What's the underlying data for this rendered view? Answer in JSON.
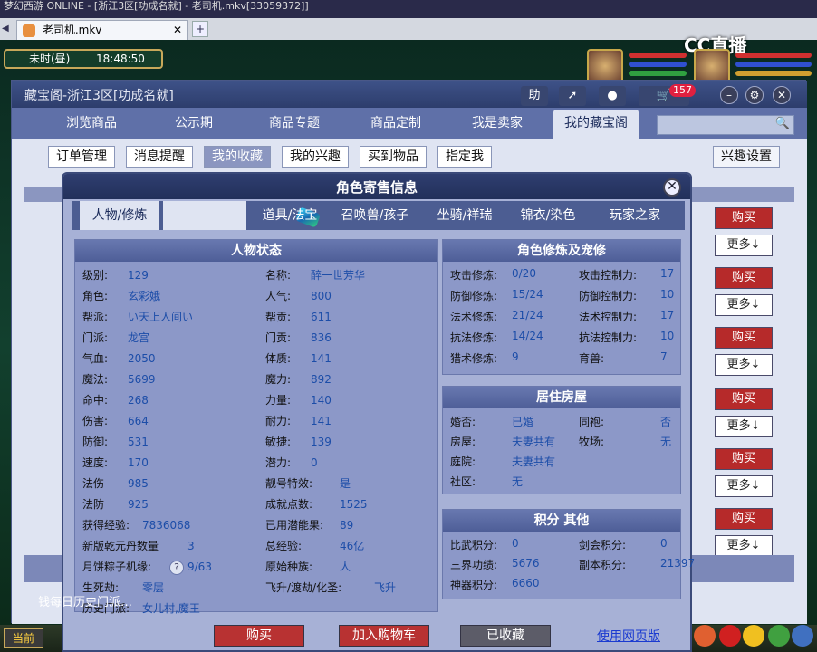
{
  "window": {
    "title": "梦幻西游 ONLINE - [浙江3区[功成名就] - 老司机.mkv[33059372]]"
  },
  "browser_tab": {
    "label": "老司机.mkv"
  },
  "hud": {
    "era": "未时(昼)",
    "clock": "18:48:50",
    "cc_logo": "CC直播"
  },
  "shop": {
    "title": "藏宝阁-浙江3区[功成名就]",
    "help_label": "助",
    "cart_count": "157",
    "nav": [
      "浏览商品",
      "公示期",
      "商品专题",
      "商品定制",
      "我是卖家",
      "我的藏宝阁"
    ],
    "subnav": [
      "订单管理",
      "消息提醒",
      "我的收藏",
      "我的兴趣",
      "买到物品",
      "指定我"
    ],
    "settings_label": "兴趣设置",
    "row_buy": "购买",
    "row_more": "更多↓"
  },
  "dialog": {
    "title": "角色寄售信息",
    "tabs": [
      "人物/修炼",
      "",
      "道具/法宝",
      "召唤兽/孩子",
      "坐骑/祥瑞",
      "锦衣/染色",
      "玩家之家"
    ],
    "status": {
      "header": "人物状态",
      "left": [
        {
          "k": "级别:",
          "v": "129"
        },
        {
          "k": "角色:",
          "v": "玄彩娥"
        },
        {
          "k": "帮派:",
          "v": "い天上人间い"
        },
        {
          "k": "门派:",
          "v": "龙宫"
        },
        {
          "k": "气血:",
          "v": "2050"
        },
        {
          "k": "魔法:",
          "v": "5699"
        },
        {
          "k": "命中:",
          "v": "268"
        },
        {
          "k": "伤害:",
          "v": "664"
        },
        {
          "k": "防御:",
          "v": "531"
        },
        {
          "k": "速度:",
          "v": "170"
        },
        {
          "k": "法伤",
          "v": "985"
        },
        {
          "k": "法防",
          "v": "925"
        },
        {
          "k": "获得经验:",
          "v": "7836068"
        },
        {
          "k": "新版乾元丹数量",
          "v": "3"
        },
        {
          "k": "月饼粽子机缘:",
          "v": "9/63"
        },
        {
          "k": "生死劫:",
          "v": "零层"
        },
        {
          "k": "历史门派:",
          "v": "女儿村,魔王"
        }
      ],
      "right": [
        {
          "k": "名称:",
          "v": "醉一世芳华"
        },
        {
          "k": "人气:",
          "v": "800"
        },
        {
          "k": "帮贡:",
          "v": "611"
        },
        {
          "k": "门贡:",
          "v": "836"
        },
        {
          "k": "体质:",
          "v": "141"
        },
        {
          "k": "魔力:",
          "v": "892"
        },
        {
          "k": "力量:",
          "v": "140"
        },
        {
          "k": "耐力:",
          "v": "141"
        },
        {
          "k": "敏捷:",
          "v": "139"
        },
        {
          "k": "潜力:",
          "v": "0"
        },
        {
          "k": "靓号特效:",
          "v": "是"
        },
        {
          "k": "成就点数:",
          "v": "1525"
        },
        {
          "k": "已用潜能果:",
          "v": "89"
        },
        {
          "k": "总经验:",
          "v": "46亿"
        },
        {
          "k": "原始种族:",
          "v": "人"
        },
        {
          "k": "飞升/渡劫/化圣:",
          "v": "飞升"
        }
      ]
    },
    "cultivation": {
      "header": "角色修炼及宠修",
      "rows": [
        {
          "k1": "攻击修炼:",
          "v1": "0/20",
          "k2": "攻击控制力:",
          "v2": "17"
        },
        {
          "k1": "防御修炼:",
          "v1": "15/24",
          "k2": "防御控制力:",
          "v2": "10"
        },
        {
          "k1": "法术修炼:",
          "v1": "21/24",
          "k2": "法术控制力:",
          "v2": "17"
        },
        {
          "k1": "抗法修炼:",
          "v1": "14/24",
          "k2": "抗法控制力:",
          "v2": "10"
        },
        {
          "k1": "猎术修炼:",
          "v1": "9",
          "k2": "育兽:",
          "v2": "7"
        }
      ]
    },
    "house": {
      "header": "居住房屋",
      "rows": [
        {
          "k1": "婚否:",
          "v1": "已婚",
          "k2": "同袍:",
          "v2": "否"
        },
        {
          "k1": "房屋:",
          "v1": "夫妻共有",
          "k2": "牧场:",
          "v2": "无"
        },
        {
          "k1": "庭院:",
          "v1": "夫妻共有",
          "k2": "",
          "v2": ""
        },
        {
          "k1": "社区:",
          "v1": "无",
          "k2": "",
          "v2": ""
        }
      ]
    },
    "points": {
      "header": "积分 其他",
      "rows": [
        {
          "k1": "比武积分:",
          "v1": "0",
          "k2": "剑会积分:",
          "v2": "0"
        },
        {
          "k1": "三界功绩:",
          "v1": "5676",
          "k2": "副本积分:",
          "v2": "21397"
        },
        {
          "k1": "神器积分:",
          "v1": "6660",
          "k2": "",
          "v2": ""
        }
      ]
    },
    "buttons": {
      "buy": "购买",
      "cart": "加入购物车",
      "fav": "已收藏",
      "web": "使用网页版"
    }
  },
  "chat": {
    "prefix": "钱",
    "text": "每日历史门派…"
  },
  "bottom": {
    "current": "当前"
  }
}
